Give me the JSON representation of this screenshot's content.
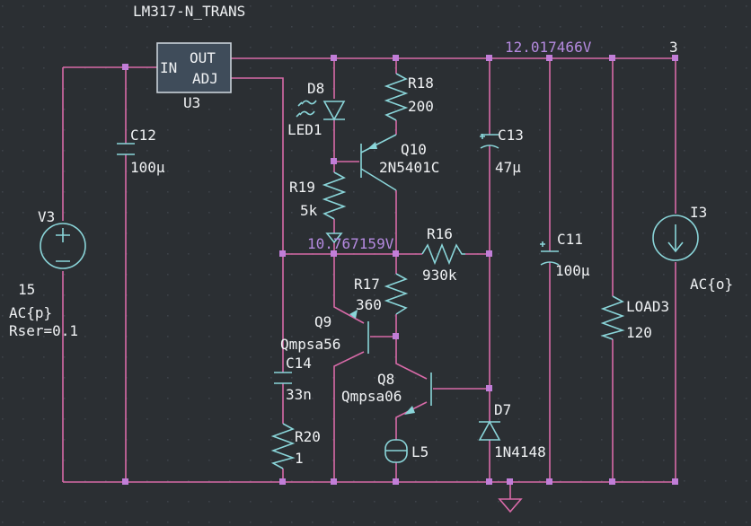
{
  "title": "LM317-N_TRANS",
  "u3": {
    "ref": "U3",
    "pin_in": "IN",
    "pin_out": "OUT",
    "pin_adj": "ADJ"
  },
  "node_labels": {
    "v_out": "12.017466V",
    "v_mid": "10.767159V",
    "net3": "3"
  },
  "v3": {
    "ref": "V3",
    "value": "15",
    "line2": "AC{p}",
    "line3": "Rser=0.1"
  },
  "c12": {
    "ref": "C12",
    "value": "100µ"
  },
  "d8": {
    "ref": "D8",
    "model": "LED1"
  },
  "r18": {
    "ref": "R18",
    "value": "200"
  },
  "q10": {
    "ref": "Q10",
    "model": "2N5401C"
  },
  "c13": {
    "ref": "C13",
    "value": "47µ"
  },
  "r19": {
    "ref": "R19",
    "value": "5k"
  },
  "r16": {
    "ref": "R16",
    "value": "930k"
  },
  "c11": {
    "ref": "C11",
    "value": "100µ"
  },
  "i3": {
    "ref": "I3",
    "value": "AC{o}"
  },
  "load3": {
    "ref": "LOAD3",
    "value": "120"
  },
  "r17": {
    "ref": "R17",
    "value": "360"
  },
  "q9": {
    "ref": "Q9",
    "model": "Qmpsa56"
  },
  "c14": {
    "ref": "C14",
    "value": "33n"
  },
  "q8": {
    "ref": "Q8",
    "model": "Qmpsa06"
  },
  "d7": {
    "ref": "D7",
    "model": "1N4148"
  },
  "r20": {
    "ref": "R20",
    "value": "1"
  },
  "l5": {
    "ref": "L5"
  },
  "colors": {
    "background": "#2b2f33",
    "wire": "#d86aa8",
    "component": "#8ad5d9",
    "junction": "#c17ed8",
    "label": "#f0f2f4",
    "voltage": "#b58ae0"
  }
}
